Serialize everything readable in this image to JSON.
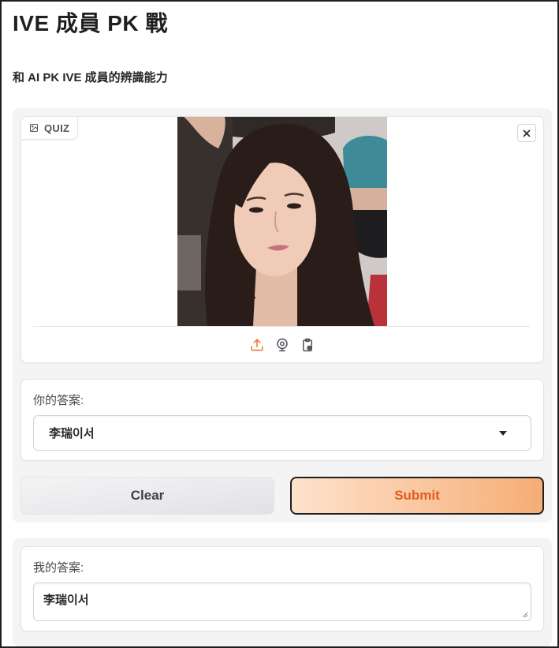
{
  "app": {
    "title": "IVE 成員 PK 戰",
    "subtitle": "和 AI PK IVE 成員的辨識能力"
  },
  "quiz": {
    "label": "QUIZ",
    "label_icon": "image-icon",
    "clear_icon": "close-icon",
    "source_icons": [
      "upload-icon",
      "webcam-icon",
      "clipboard-icon"
    ],
    "active_source": "upload-icon"
  },
  "answer_dropdown": {
    "label": "你的答案:",
    "value": "李瑞이서",
    "icon": "chevron-down-icon"
  },
  "buttons": {
    "clear": "Clear",
    "submit": "Submit"
  },
  "result": {
    "label": "我的答案:",
    "value": "李瑞이서"
  },
  "colors": {
    "accent": "#e8742a",
    "submit_text": "#de5f1e",
    "panel_bg": "#f4f4f5"
  }
}
